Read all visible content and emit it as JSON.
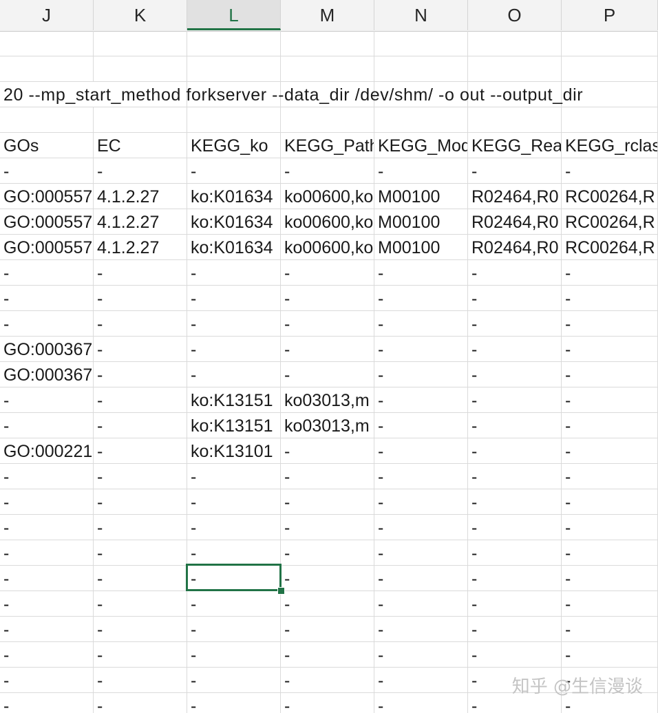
{
  "columns": [
    "J",
    "K",
    "L",
    "M",
    "N",
    "O",
    "P"
  ],
  "selected_column": "L",
  "rows": [
    [
      "",
      "",
      "",
      "",
      "",
      "",
      ""
    ],
    [
      "",
      "",
      "",
      "",
      "",
      "",
      ""
    ],
    [
      "20 --mp_start_method forkserver --data_dir /dev/shm/ -o out --output_dir",
      "",
      "",
      "",
      "",
      "",
      ""
    ],
    [
      "",
      "",
      "",
      "",
      "",
      "",
      ""
    ],
    [
      "GOs",
      "EC",
      "KEGG_ko",
      "KEGG_Path",
      "KEGG_Mod",
      "KEGG_Rea",
      "KEGG_rclas"
    ],
    [
      "-",
      "-",
      "-",
      "-",
      "-",
      "-",
      "-"
    ],
    [
      "GO:000557",
      "4.1.2.27",
      "ko:K01634",
      "ko00600,ko",
      "M00100",
      "R02464,R0",
      "RC00264,R"
    ],
    [
      "GO:000557",
      "4.1.2.27",
      "ko:K01634",
      "ko00600,ko",
      "M00100",
      "R02464,R0",
      "RC00264,R"
    ],
    [
      "GO:000557",
      "4.1.2.27",
      "ko:K01634",
      "ko00600,ko",
      "M00100",
      "R02464,R0",
      "RC00264,R"
    ],
    [
      "-",
      "-",
      "-",
      "-",
      "-",
      "-",
      "-"
    ],
    [
      "-",
      "-",
      "-",
      "-",
      "-",
      "-",
      "-"
    ],
    [
      "-",
      "-",
      "-",
      "-",
      "-",
      "-",
      "-"
    ],
    [
      "GO:000367",
      "-",
      "-",
      "-",
      "-",
      "-",
      "-"
    ],
    [
      "GO:000367",
      "-",
      "-",
      "-",
      "-",
      "-",
      "-"
    ],
    [
      "-",
      "-",
      "ko:K13151",
      "ko03013,m",
      "-",
      "-",
      "-"
    ],
    [
      "-",
      "-",
      "ko:K13151",
      "ko03013,m",
      "-",
      "-",
      "-"
    ],
    [
      "GO:000221",
      "-",
      "ko:K13101",
      "-",
      "-",
      "-",
      "-"
    ],
    [
      "-",
      "-",
      "-",
      "-",
      "-",
      "-",
      "-"
    ],
    [
      "-",
      "-",
      "-",
      "-",
      "-",
      "-",
      "-"
    ],
    [
      "-",
      "-",
      "-",
      "-",
      "-",
      "-",
      "-"
    ],
    [
      "-",
      "-",
      "-",
      "-",
      "-",
      "-",
      "-"
    ],
    [
      "-",
      "-",
      "-",
      "-",
      "-",
      "-",
      "-"
    ],
    [
      "-",
      "-",
      "-",
      "-",
      "-",
      "-",
      "-"
    ],
    [
      "-",
      "-",
      "-",
      "-",
      "-",
      "-",
      "-"
    ],
    [
      "-",
      "-",
      "-",
      "-",
      "-",
      "-",
      "-"
    ],
    [
      "-",
      "-",
      "-",
      "-",
      "-",
      "-",
      "-"
    ],
    [
      "-",
      "-",
      "-",
      "-",
      "-",
      "-",
      "-"
    ],
    [
      "-",
      "-",
      "-",
      "-",
      "-",
      "-",
      "-"
    ]
  ],
  "active_cell": "L",
  "watermark": "知乎 @生信漫谈",
  "colors": {
    "accent": "#217346",
    "header_bg": "#f3f3f3",
    "gridline": "#dadada"
  }
}
